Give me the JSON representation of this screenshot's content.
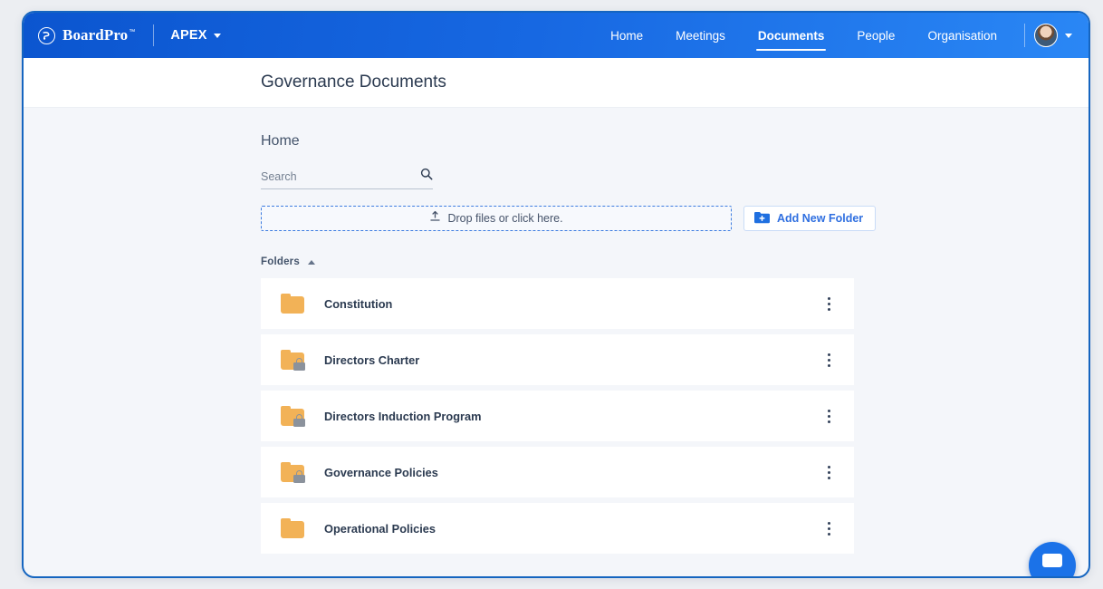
{
  "brand": {
    "name": "BoardPro",
    "trademark": "™",
    "logo_icon": "boardpro-circle-logo"
  },
  "org_switcher": {
    "label": "APEX",
    "caret_icon": "caret-down-icon"
  },
  "nav": {
    "items": [
      {
        "label": "Home",
        "active": false
      },
      {
        "label": "Meetings",
        "active": false
      },
      {
        "label": "Documents",
        "active": true
      },
      {
        "label": "People",
        "active": false
      },
      {
        "label": "Organisation",
        "active": false
      }
    ],
    "user_menu": {
      "avatar_icon": "user-avatar",
      "caret_icon": "caret-down-icon"
    }
  },
  "header": {
    "title": "Governance Documents"
  },
  "main": {
    "breadcrumb": "Home",
    "search": {
      "placeholder": "Search",
      "value": "",
      "icon": "search-icon"
    },
    "dropzone": {
      "label": "Drop files or click here.",
      "icon": "upload-icon"
    },
    "add_folder_button": {
      "label": "Add New Folder",
      "icon": "folder-plus-icon"
    },
    "folders_section": {
      "title": "Folders",
      "chevron_icon": "chevron-up-icon",
      "expanded": true,
      "rows": [
        {
          "name": "Constitution",
          "locked": false,
          "icon": "folder-icon",
          "menu_icon": "more-vertical-icon"
        },
        {
          "name": "Directors Charter",
          "locked": true,
          "icon": "folder-locked-icon",
          "menu_icon": "more-vertical-icon"
        },
        {
          "name": "Directors Induction Program",
          "locked": true,
          "icon": "folder-locked-icon",
          "menu_icon": "more-vertical-icon"
        },
        {
          "name": "Governance Policies",
          "locked": true,
          "icon": "folder-locked-icon",
          "menu_icon": "more-vertical-icon"
        },
        {
          "name": "Operational Policies",
          "locked": false,
          "icon": "folder-icon",
          "menu_icon": "more-vertical-icon"
        }
      ]
    }
  },
  "chat_widget": {
    "icon": "chat-bubble-icon"
  },
  "colors": {
    "brand_blue": "#1768e2",
    "folder_orange": "#f2b257",
    "link_blue": "#2f6fe0",
    "page_bg": "#f4f6fa",
    "lock_gray": "#8b929c"
  }
}
